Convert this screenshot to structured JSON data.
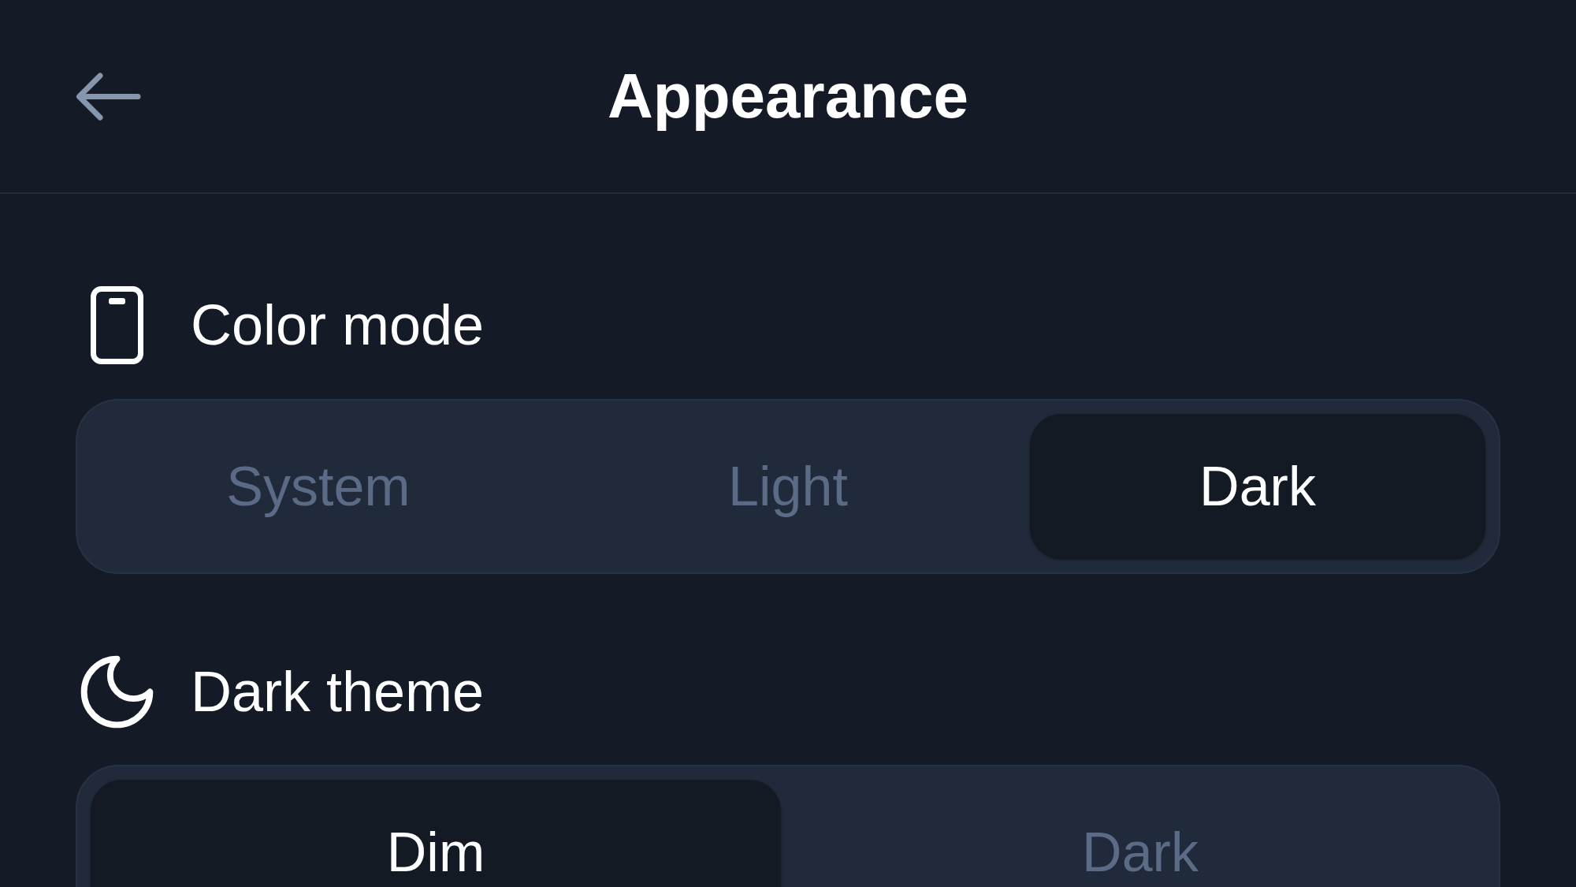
{
  "header": {
    "title": "Appearance"
  },
  "color_mode": {
    "label": "Color mode",
    "options": [
      {
        "label": "System",
        "selected": false
      },
      {
        "label": "Light",
        "selected": false
      },
      {
        "label": "Dark",
        "selected": true
      }
    ]
  },
  "dark_theme": {
    "label": "Dark theme",
    "options": [
      {
        "label": "Dim",
        "selected": true
      },
      {
        "label": "Dark",
        "selected": false
      }
    ]
  }
}
